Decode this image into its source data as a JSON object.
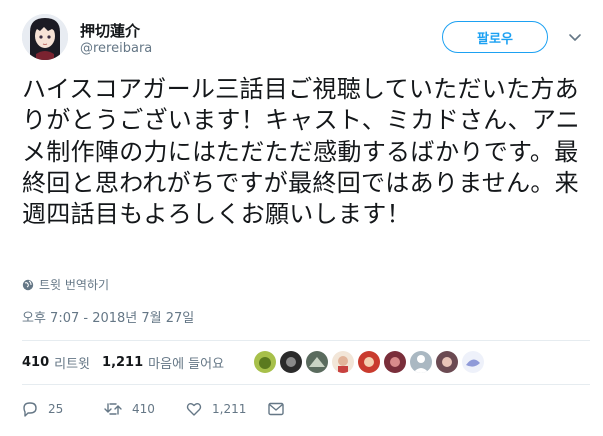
{
  "author": {
    "name": "押切蓮介",
    "handle": "@rereibara",
    "avatar_icon": "avatar-anime-girl-dark-hair"
  },
  "follow_button": {
    "label": "팔로우"
  },
  "tweet": {
    "text": "ハイスコアガール三話目ご視聴していただいた方ありがとうございます！キャスト、ミカドさん、アニメ制作陣の力にはただただ感動するばかりです。最終回と思われがちですが最終回ではありません。来週四話目もよろしくお願いします！"
  },
  "translate": {
    "label": "트윗 번역하기",
    "icon": "globe-icon"
  },
  "timestamp": "오후 7:07 - 2018년 7월 27일",
  "stats": {
    "retweets_count": "410",
    "retweets_label": "리트윗",
    "likes_count": "1,211",
    "likes_label": "마음에 들어요"
  },
  "likers": [
    {
      "icon": "liker-avatar-1"
    },
    {
      "icon": "liker-avatar-2"
    },
    {
      "icon": "liker-avatar-3"
    },
    {
      "icon": "liker-avatar-4"
    },
    {
      "icon": "liker-avatar-5"
    },
    {
      "icon": "liker-avatar-6"
    },
    {
      "icon": "liker-avatar-7"
    },
    {
      "icon": "liker-avatar-8"
    },
    {
      "icon": "liker-avatar-9"
    }
  ],
  "actions": {
    "reply_count": "25",
    "retweet_count": "410",
    "like_count": "1,211"
  },
  "colors": {
    "accent": "#1da1f2",
    "secondary_text": "#657786",
    "divider": "#e6ecf0"
  }
}
